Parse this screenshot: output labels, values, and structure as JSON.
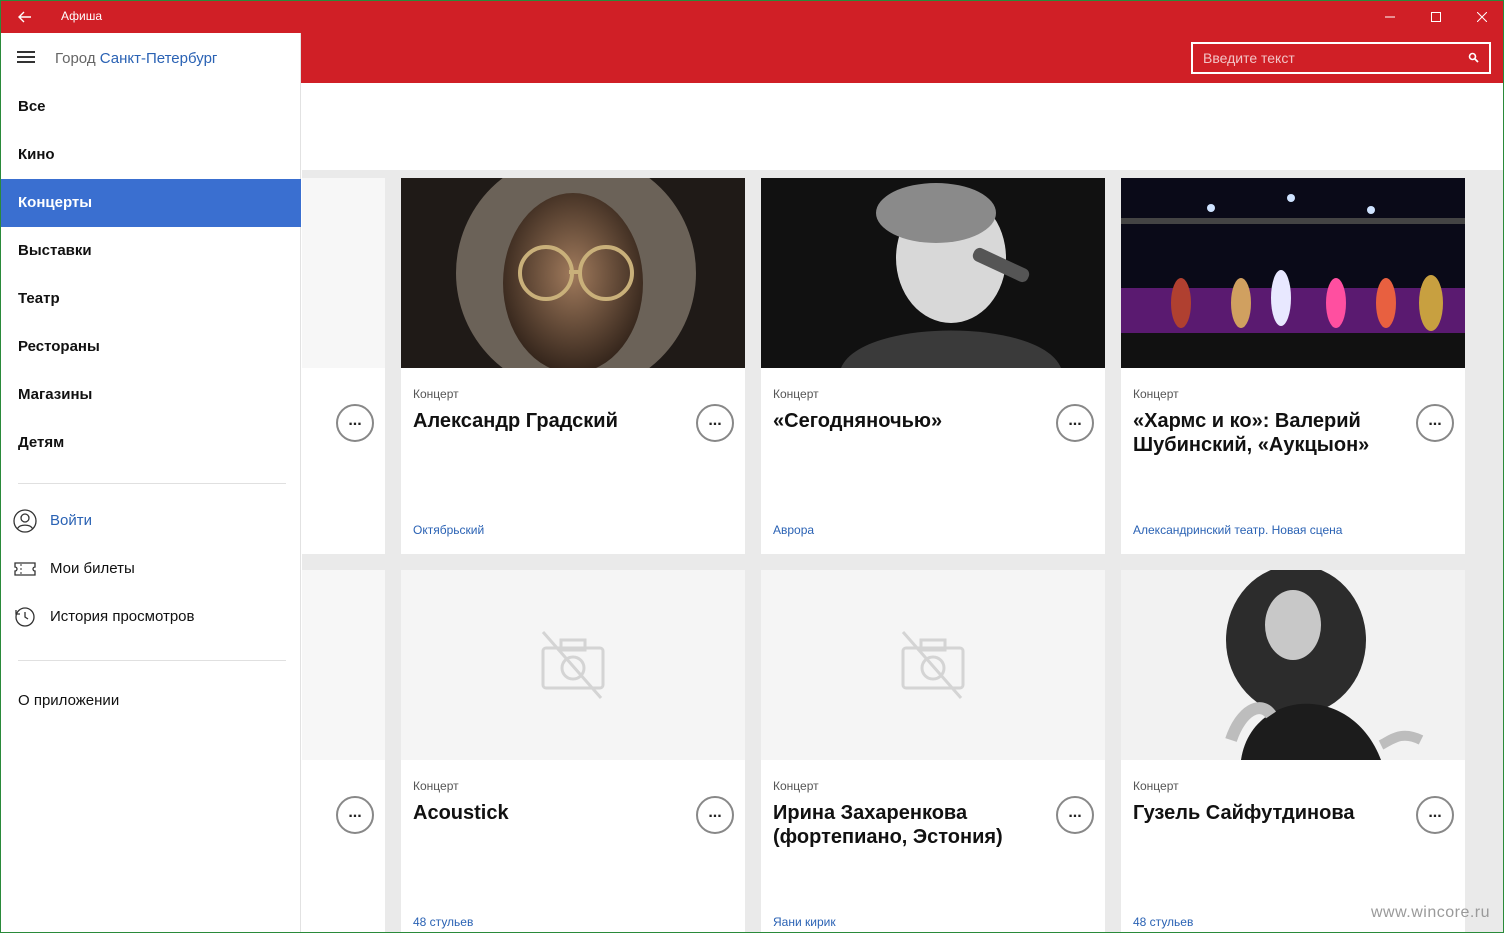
{
  "window": {
    "title": "Афиша"
  },
  "search": {
    "placeholder": "Введите текст"
  },
  "sidebar": {
    "city_prefix": "Город",
    "city_name": "Санкт-Петербург",
    "items": [
      {
        "label": "Все",
        "active": false
      },
      {
        "label": "Кино",
        "active": false
      },
      {
        "label": "Концерты",
        "active": true
      },
      {
        "label": "Выставки",
        "active": false
      },
      {
        "label": "Театр",
        "active": false
      },
      {
        "label": "Рестораны",
        "active": false
      },
      {
        "label": "Магазины",
        "active": false
      },
      {
        "label": "Детям",
        "active": false
      }
    ],
    "account": [
      {
        "label": "Войти",
        "icon": "user-circle-icon"
      },
      {
        "label": "Мои билеты",
        "icon": "ticket-icon"
      },
      {
        "label": "История просмотров",
        "icon": "history-icon"
      }
    ],
    "about": "О приложении"
  },
  "cards": [
    {
      "category": "Концерт",
      "title": "Александр Градский",
      "venue": "Октябрьский",
      "more": "...",
      "image": "portrait-man-glasses"
    },
    {
      "category": "Концерт",
      "title": "«Сегодняночью»",
      "venue": "Аврора",
      "more": "...",
      "image": "singer-microphone"
    },
    {
      "category": "Концерт",
      "title": "«Хармс и ко»: Валерий Шубинский, «Аукцыон»",
      "venue": "Александринский театр. Новая сцена",
      "more": "...",
      "image": "concert-stage"
    },
    {
      "category": "Концерт",
      "title": "Acoustick",
      "venue": "48 стульев",
      "more": "...",
      "image": "no-image"
    },
    {
      "category": "Концерт",
      "title": "Ирина Захаренкова (фортепиано, Эстония)",
      "venue": "Яани кирик",
      "more": "...",
      "image": "no-image"
    },
    {
      "category": "Концерт",
      "title": "Гузель Сайфутдинова",
      "venue": "48 стульев",
      "more": "...",
      "image": "singer-woman"
    }
  ],
  "partial_more": "...",
  "watermark": "www.wincore.ru",
  "colors": {
    "brand_red": "#d01f26",
    "active_blue": "#3a6fd0",
    "link_blue": "#2a62b4"
  }
}
